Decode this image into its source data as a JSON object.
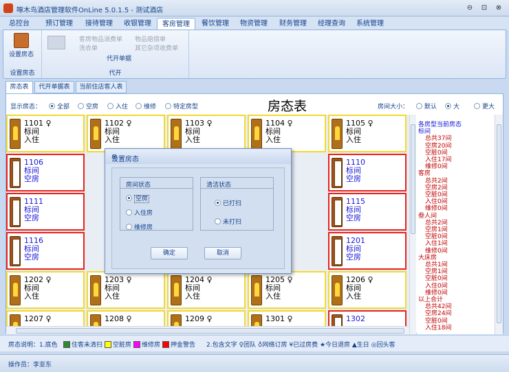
{
  "app": {
    "title": "啄木鸟酒店管理软件OnLine 5.0.1.5 - 测试酒店",
    "minimize": "⊖",
    "restore": "⊡",
    "close": "⊗"
  },
  "menu_tabs": [
    "总控台",
    "预订管理",
    "接待管理",
    "收银管理",
    "客房管理",
    "餐饮管理",
    "物资管理",
    "财务管理",
    "经理查询",
    "系统管理"
  ],
  "ribbon": {
    "set_status": "设置房态",
    "group1": "设置房态",
    "small": [
      "客房物品消费单",
      "洗衣单",
      "物品赔偿单",
      "其它杂项收费单"
    ],
    "sub_label": "代开单据",
    "group2": "代开"
  },
  "sub_tabs": [
    "房态表",
    "代开单据表",
    "当前住店客人表"
  ],
  "filter": {
    "label": "显示房态：",
    "options": [
      "全部",
      "空房",
      "入住",
      "维修",
      "特定房型"
    ],
    "title": "房态表",
    "size_label": "房间大小：",
    "sizes": [
      "默认",
      "大",
      "更大"
    ]
  },
  "rooms": [
    [
      {
        "no": "1101",
        "sym": "♀",
        "type": "标间",
        "st": "入住",
        "k": "occ"
      },
      {
        "no": "1102",
        "sym": "♀",
        "type": "标间",
        "st": "入住",
        "k": "occ"
      },
      {
        "no": "1103",
        "sym": "♀",
        "type": "标间",
        "st": "入住",
        "k": "occ"
      },
      {
        "no": "1104",
        "sym": "♀",
        "type": "标间",
        "st": "入住",
        "k": "occ"
      },
      {
        "no": "1105",
        "sym": "♀",
        "type": "标间",
        "st": "入住",
        "k": "occ"
      }
    ],
    [
      {
        "no": "1106",
        "sym": "",
        "type": "标间",
        "st": "空房",
        "k": "vac"
      },
      null,
      null,
      null,
      {
        "no": "1110",
        "sym": "",
        "type": "标间",
        "st": "空房",
        "k": "vac"
      }
    ],
    [
      {
        "no": "1111",
        "sym": "",
        "type": "标间",
        "st": "空房",
        "k": "vac"
      },
      null,
      null,
      null,
      {
        "no": "1115",
        "sym": "",
        "type": "标间",
        "st": "空房",
        "k": "vac"
      }
    ],
    [
      {
        "no": "1116",
        "sym": "",
        "type": "标间",
        "st": "空房",
        "k": "vac"
      },
      null,
      null,
      null,
      {
        "no": "1201",
        "sym": "",
        "type": "标间",
        "st": "空房",
        "k": "vac"
      }
    ],
    [
      {
        "no": "1202",
        "sym": "♀",
        "type": "标间",
        "st": "入住",
        "k": "occ"
      },
      {
        "no": "1203",
        "sym": "♀",
        "type": "标间",
        "st": "入住",
        "k": "occ"
      },
      {
        "no": "1204",
        "sym": "♀",
        "type": "标间",
        "st": "入住",
        "k": "occ"
      },
      {
        "no": "1205",
        "sym": "♀",
        "type": "标间",
        "st": "入住",
        "k": "occ"
      },
      {
        "no": "1206",
        "sym": "♀",
        "type": "标间",
        "st": "入住",
        "k": "occ"
      }
    ],
    [
      {
        "no": "1207",
        "sym": "♀",
        "type": "",
        "st": "",
        "k": "occ"
      },
      {
        "no": "1208",
        "sym": "♀",
        "type": "",
        "st": "",
        "k": "occ"
      },
      {
        "no": "1209",
        "sym": "♀",
        "type": "",
        "st": "",
        "k": "occ"
      },
      {
        "no": "1301",
        "sym": "♀",
        "type": "",
        "st": "",
        "k": "occ"
      },
      {
        "no": "1302",
        "sym": "",
        "type": "",
        "st": "",
        "k": "vac"
      }
    ]
  ],
  "summary": [
    {
      "t": "各房型当前房态",
      "c": "#1515d8"
    },
    {
      "t": "标间",
      "c": "#1515d8"
    },
    {
      "t": "总共37间",
      "c": "#c00000",
      "i": 1
    },
    {
      "t": "空房20间",
      "c": "#c00000",
      "i": 1
    },
    {
      "t": "空脏0间",
      "c": "#c00000",
      "i": 1
    },
    {
      "t": "入住17间",
      "c": "#c00000",
      "i": 1
    },
    {
      "t": "维修0间",
      "c": "#c00000",
      "i": 1
    },
    {
      "t": "客房",
      "c": "#c00000"
    },
    {
      "t": "总共2间",
      "c": "#c00000",
      "i": 1
    },
    {
      "t": "空房2间",
      "c": "#c00000",
      "i": 1
    },
    {
      "t": "空脏0间",
      "c": "#c00000",
      "i": 1
    },
    {
      "t": "入住0间",
      "c": "#c00000",
      "i": 1
    },
    {
      "t": "维修0间",
      "c": "#c00000",
      "i": 1
    },
    {
      "t": "叁人间",
      "c": "#c00000"
    },
    {
      "t": "总共2间",
      "c": "#c00000",
      "i": 1
    },
    {
      "t": "空房1间",
      "c": "#c00000",
      "i": 1
    },
    {
      "t": "空脏0间",
      "c": "#c00000",
      "i": 1
    },
    {
      "t": "入住1间",
      "c": "#c00000",
      "i": 1
    },
    {
      "t": "维修0间",
      "c": "#c00000",
      "i": 1
    },
    {
      "t": "大床房",
      "c": "#c00000"
    },
    {
      "t": "总共1间",
      "c": "#c00000",
      "i": 1
    },
    {
      "t": "空房1间",
      "c": "#c00000",
      "i": 1
    },
    {
      "t": "空脏0间",
      "c": "#c00000",
      "i": 1
    },
    {
      "t": "入住0间",
      "c": "#c00000",
      "i": 1
    },
    {
      "t": "维修0间",
      "c": "#c00000",
      "i": 1
    },
    {
      "t": "以上合计",
      "c": "#c00000"
    },
    {
      "t": "总共42间",
      "c": "#c00000",
      "i": 1
    },
    {
      "t": "空房24间",
      "c": "#c00000",
      "i": 1
    },
    {
      "t": "空脏0间",
      "c": "#c00000",
      "i": 1
    },
    {
      "t": "入住18间",
      "c": "#c00000",
      "i": 1
    }
  ],
  "legend": {
    "label": "房态说明：1.底色",
    "items": [
      {
        "t": "住客未清扫",
        "c": "#2f8a2f"
      },
      {
        "t": "空脏房",
        "c": "#ffff00"
      },
      {
        "t": "维修房",
        "c": "#ff00ff"
      },
      {
        "t": "押金警告",
        "c": "#ff0000"
      }
    ],
    "part2": "2.包含文字 ♀团队 ♁网络订房 ¥已过房费 ★今日退房 ▲生日 ◎回头客"
  },
  "status": "操作员：李亚东",
  "dialog": {
    "title": "设置房态",
    "close": "⊗",
    "room_group": "房间状态",
    "room_opts": [
      "空房",
      "入住房",
      "维修房"
    ],
    "clean_group": "清洁状态",
    "clean_opts": [
      "已打扫",
      "未打扫"
    ],
    "ok": "确定",
    "cancel": "取消"
  }
}
